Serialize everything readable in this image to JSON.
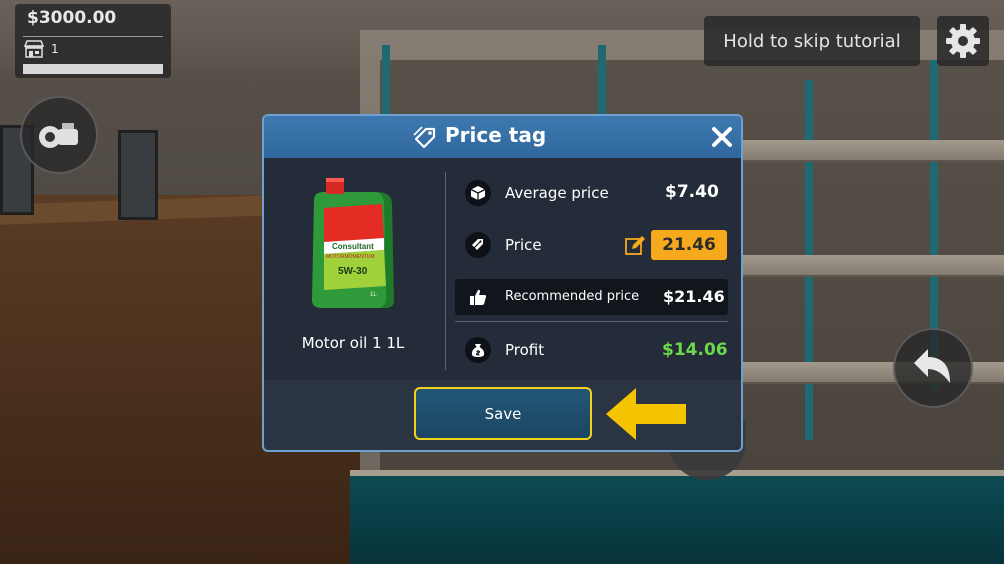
{
  "hud": {
    "money": "$3000.00",
    "store_level": "1",
    "xp_progress_fraction": 0
  },
  "tutorial": {
    "skip_label": "Hold to skip tutorial"
  },
  "dialog": {
    "title": "Price tag",
    "product_name": "Motor oil 1 1L",
    "product_label": {
      "brand": "Consultant",
      "subtitle": "MOTORMOMENTUM",
      "grade": "5W-30",
      "volume": "1L"
    },
    "average_price_label": "Average price",
    "average_price_value": "$7.40",
    "price_label": "Price",
    "price_value": "21.46",
    "recommended_price_label": "Recommended price",
    "recommended_price_value": "$21.46",
    "profit_label": "Profit",
    "profit_value": "$14.06",
    "save_label": "Save"
  },
  "colors": {
    "header_blue": "#3d79b0",
    "panel_dark": "#232c38",
    "price_orange": "#f6a91c",
    "profit_green": "#6bd94a",
    "save_border": "#f0d21f",
    "arrow_yellow": "#f5c400"
  },
  "icons": {
    "tag": "price-tag-icon",
    "close": "close-icon",
    "average": "box-icon",
    "price": "price-tags-icon",
    "recommended": "thumbs-up-icon",
    "profit": "money-bag-icon",
    "edit": "pencil-icon",
    "settings": "gear-icon",
    "tools": "tools-icon",
    "rotate": "rotate-icon",
    "store": "store-icon"
  }
}
